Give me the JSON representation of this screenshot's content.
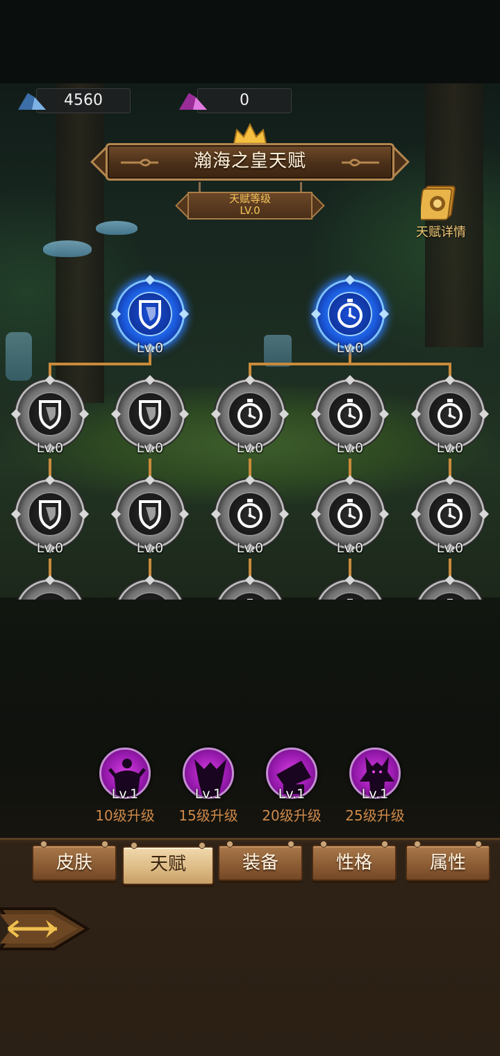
{
  "currency": [
    {
      "icon": "blue-crystal-icon",
      "value": "4560"
    },
    {
      "icon": "purple-crystal-icon",
      "value": "0"
    }
  ],
  "banner": {
    "title": "瀚海之皇天赋"
  },
  "talent_level": {
    "label": "天赋等级",
    "value": "LV.0"
  },
  "details": {
    "label": "天赋详情"
  },
  "tree": {
    "roots": [
      {
        "icon": "shield-icon",
        "level": "Lv.0"
      },
      {
        "icon": "stopwatch-icon",
        "level": "Lv.0"
      }
    ],
    "row1": [
      {
        "icon": "shield-icon",
        "level": "Lv.0"
      },
      {
        "icon": "shield-icon",
        "level": "Lv.0"
      },
      {
        "icon": "stopwatch-icon",
        "level": "Lv.0"
      },
      {
        "icon": "stopwatch-icon",
        "level": "Lv.0"
      },
      {
        "icon": "stopwatch-icon",
        "level": "Lv.0"
      }
    ],
    "row2": [
      {
        "icon": "shield-icon",
        "level": "Lv.0"
      },
      {
        "icon": "shield-icon",
        "level": "Lv.0"
      },
      {
        "icon": "stopwatch-icon",
        "level": "Lv.0"
      },
      {
        "icon": "stopwatch-icon",
        "level": "Lv.0"
      },
      {
        "icon": "stopwatch-icon",
        "level": "Lv.0"
      }
    ]
  },
  "skills": [
    {
      "icon": "silhouette-hero-icon",
      "level": "Lv.1",
      "requirement": "10级升级"
    },
    {
      "icon": "silhouette-beast-icon",
      "level": "Lv.1",
      "requirement": "15级升级"
    },
    {
      "icon": "silhouette-cannon-icon",
      "level": "Lv.1",
      "requirement": "20级升级"
    },
    {
      "icon": "silhouette-demon-icon",
      "level": "Lv.1",
      "requirement": "25级升级"
    }
  ],
  "tabs": [
    {
      "label": "皮肤",
      "active": false
    },
    {
      "label": "天赋",
      "active": true
    },
    {
      "label": "装备",
      "active": false
    },
    {
      "label": "性格",
      "active": false
    },
    {
      "label": "属性",
      "active": false
    }
  ],
  "back_button": {
    "icon": "back-arrow-icon"
  },
  "colors": {
    "gold_text": "#f5c55a",
    "tab_wood": "#8a5b33",
    "active_node": "#1d5fe0",
    "skill_magenta": "#9a1bb0"
  }
}
